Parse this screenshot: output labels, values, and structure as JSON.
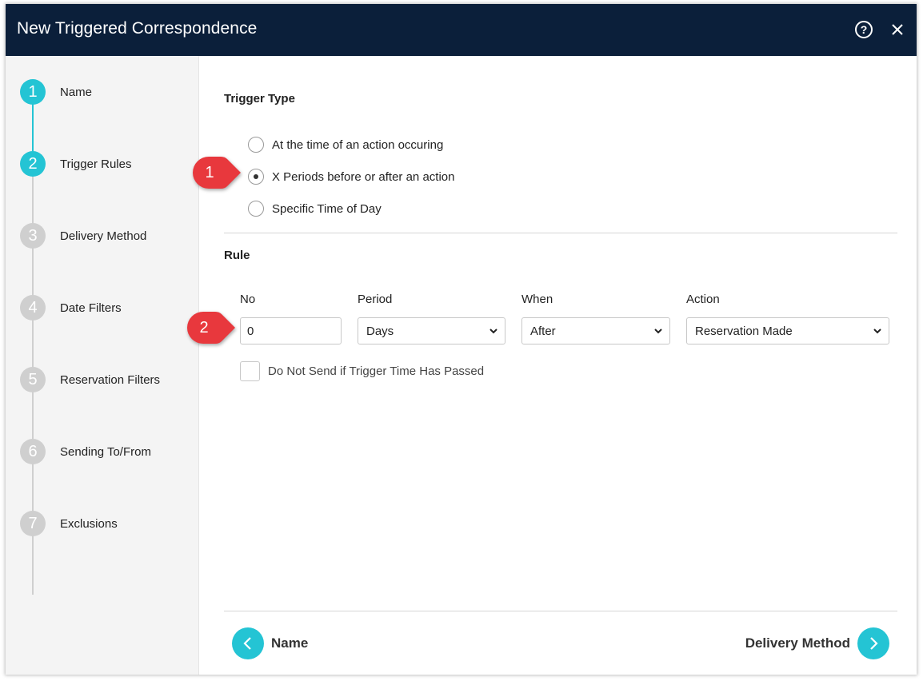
{
  "dialog": {
    "title": "New Triggered Correspondence",
    "help_symbol": "?",
    "close_symbol": "✕"
  },
  "sidebar": {
    "steps": [
      {
        "number": "1",
        "label": "Name",
        "state": "active"
      },
      {
        "number": "2",
        "label": "Trigger Rules",
        "state": "active"
      },
      {
        "number": "3",
        "label": "Delivery Method",
        "state": "inactive"
      },
      {
        "number": "4",
        "label": "Date Filters",
        "state": "inactive"
      },
      {
        "number": "5",
        "label": "Reservation Filters",
        "state": "inactive"
      },
      {
        "number": "6",
        "label": "Sending To/From",
        "state": "inactive"
      },
      {
        "number": "7",
        "label": "Exclusions",
        "state": "inactive"
      }
    ]
  },
  "trigger_type": {
    "heading": "Trigger Type",
    "options": [
      {
        "label": "At the time of an action occuring",
        "selected": false
      },
      {
        "label": "X Periods before or after an action",
        "selected": true
      },
      {
        "label": "Specific Time of Day",
        "selected": false
      }
    ]
  },
  "rule": {
    "heading": "Rule",
    "no_label": "No",
    "no_value": "0",
    "period_label": "Period",
    "period_value": "Days",
    "when_label": "When",
    "when_value": "After",
    "action_label": "Action",
    "action_value": "Reservation Made",
    "checkbox_label": "Do Not Send if Trigger Time Has Passed",
    "checkbox_checked": false
  },
  "footer": {
    "back_label": "Name",
    "next_label": "Delivery Method"
  },
  "annotations": [
    {
      "number": "1"
    },
    {
      "number": "2"
    }
  ],
  "colors": {
    "titlebar": "#0b1f3a",
    "accent": "#24c4d4",
    "inactive_step": "#cfcfcf",
    "annotation": "#e8383d"
  },
  "icons": {
    "help": "help-icon",
    "close": "close-icon",
    "back": "chevron-left-icon",
    "next": "chevron-right-icon",
    "dropdown": "chevron-down-icon"
  }
}
